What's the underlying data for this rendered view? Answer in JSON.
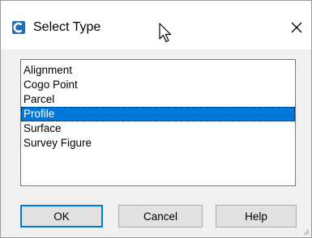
{
  "window": {
    "title": "Select Type",
    "app_icon": "app-c-icon",
    "close_glyph": "✕"
  },
  "listbox": {
    "items": [
      "Alignment",
      "Cogo Point",
      "Parcel",
      "Profile",
      "Surface",
      "Survey Figure"
    ],
    "selected_index": 3
  },
  "buttons": {
    "ok": "OK",
    "cancel": "Cancel",
    "help": "Help"
  },
  "colors": {
    "selection": "#0078d7",
    "dialog_bg": "#f0f0f0",
    "app_icon": "#1f6fb5"
  }
}
